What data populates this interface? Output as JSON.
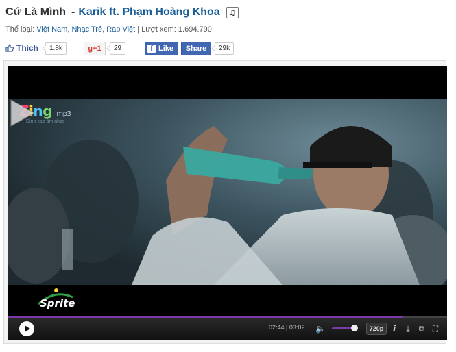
{
  "song": {
    "title": "Cứ Là Mình",
    "separator": "-",
    "artist": "Karik ft. Phạm Hoàng Khoa",
    "note_icon": "music-note-icon"
  },
  "meta": {
    "genre_label": "Thể loại:",
    "genres": [
      "Việt Nam",
      "Nhạc Trẻ",
      "Rap Việt"
    ],
    "views_label": "Lượt xem:",
    "views": "1.694.790"
  },
  "social": {
    "like_label": "Thích",
    "like_count": "1.8k",
    "gplus_label": "g+1",
    "gplus_count": "29",
    "fb_like_label": "Like",
    "fb_share_label": "Share",
    "fb_share_count": "29k"
  },
  "player": {
    "logo_text_zing": "Zing",
    "logo_text_mp3": "mp3",
    "logo_tagline": "Đỉnh cao âm nhạc",
    "sponsor_logo": "Sprite",
    "current_time": "02:44",
    "duration": "03:02",
    "time_separator": "|",
    "quality": "720p",
    "progress": 0.9,
    "volume": 0.8,
    "colors": {
      "accent": "#7b3aa8",
      "link": "#1a5e97",
      "facebook": "#4267b2"
    }
  }
}
